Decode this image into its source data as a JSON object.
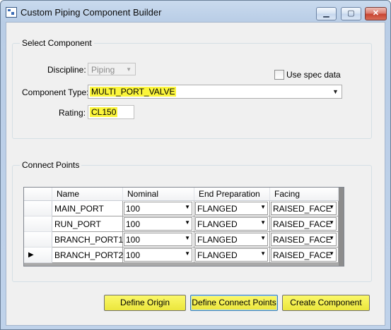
{
  "window": {
    "title": "Custom Piping Component Builder"
  },
  "select_component": {
    "group_title": "Select Component",
    "discipline_label": "Discipline:",
    "discipline_value": "Piping",
    "use_spec_label": "Use spec data",
    "use_spec_checked": false,
    "component_type_label": "Component Type:",
    "component_type_value": "MULTI_PORT_VALVE",
    "rating_label": "Rating:",
    "rating_value": "CL150"
  },
  "connect_points": {
    "group_title": "Connect Points",
    "columns": [
      "Name",
      "Nominal Diameter",
      "End Preparation",
      "Facing"
    ],
    "rows": [
      {
        "name": "MAIN_PORT",
        "diameter": "100",
        "end_prep": "FLANGED",
        "facing": "RAISED_FACE"
      },
      {
        "name": "RUN_PORT",
        "diameter": "100",
        "end_prep": "FLANGED",
        "facing": "RAISED_FACE"
      },
      {
        "name": "BRANCH_PORT1",
        "diameter": "100",
        "end_prep": "FLANGED",
        "facing": "RAISED_FACE"
      },
      {
        "name": "BRANCH_PORT2",
        "diameter": "100",
        "end_prep": "FLANGED",
        "facing": "RAISED_FACE"
      }
    ],
    "current_row_marker": "▶"
  },
  "buttons": {
    "define_origin": "Define Origin",
    "define_connect_points": "Define Connect Points",
    "create_component": "Create Component"
  },
  "colors": {
    "highlight": "#fbf53b",
    "button": "#f2ee4a"
  }
}
